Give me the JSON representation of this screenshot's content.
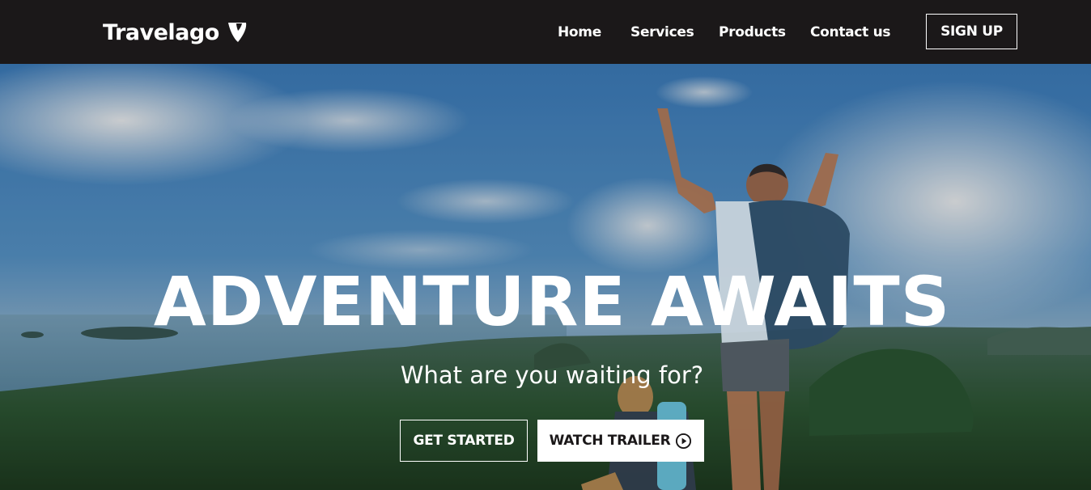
{
  "brand": {
    "name": "Travelago",
    "logo_icon": "typo3-logo-icon"
  },
  "nav": {
    "items": [
      {
        "label": "Home"
      },
      {
        "label": "Services"
      },
      {
        "label": "Products"
      },
      {
        "label": "Contact us"
      }
    ],
    "signup_label": "SIGN UP"
  },
  "hero": {
    "headline": "ADVENTURE AWAITS",
    "subheadline": "What are you waiting for?",
    "primary_button": "GET STARTED",
    "secondary_button": "WATCH TRAILER",
    "secondary_icon": "play-circle-icon",
    "background": "hikers-on-mountain-summit-photo"
  },
  "colors": {
    "navbar_bg": "#1b1819",
    "text_light": "#ffffff",
    "button_solid_bg": "#ffffff",
    "button_solid_text": "#1b1819"
  }
}
